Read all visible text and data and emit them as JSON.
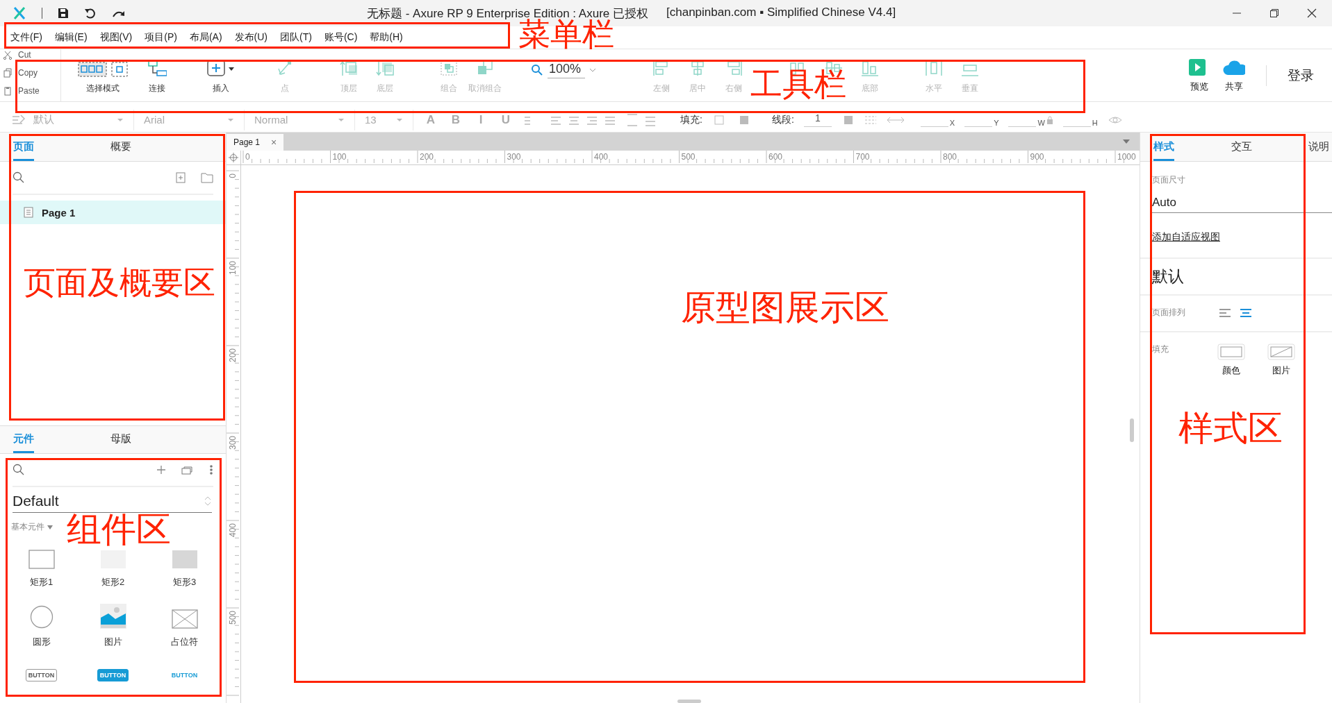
{
  "window": {
    "title": "无标题 - Axure RP 9 Enterprise Edition : Axure 已授权",
    "title_suffix": "[chanpinban.com ▪ Simplified Chinese V4.4]"
  },
  "menu": [
    "文件(F)",
    "编辑(E)",
    "视图(V)",
    "项目(P)",
    "布局(A)",
    "发布(U)",
    "团队(T)",
    "账号(C)",
    "帮助(H)"
  ],
  "clipboard": [
    "Cut",
    "Copy",
    "Paste"
  ],
  "toolbar": {
    "groups": [
      [
        {
          "label": "选择模式",
          "kind": "select",
          "disabled": false
        }
      ],
      [
        {
          "label": "连接",
          "kind": "connect",
          "disabled": false
        }
      ],
      [
        {
          "label": "插入",
          "kind": "insert",
          "disabled": false
        }
      ],
      [
        {
          "label": "点",
          "kind": "point",
          "disabled": true
        }
      ],
      [
        {
          "label": "顶层",
          "kind": "front",
          "disabled": true
        },
        {
          "label": "底层",
          "kind": "back",
          "disabled": true
        }
      ],
      [
        {
          "label": "组合",
          "kind": "group",
          "disabled": true
        },
        {
          "label": "取消组合",
          "kind": "ungroup",
          "disabled": true
        }
      ],
      [
        {
          "kind": "zoom",
          "value": "100%"
        }
      ],
      [
        {
          "label": "左侧",
          "kind": "align-left",
          "disabled": true
        },
        {
          "label": "居中",
          "kind": "align-center",
          "disabled": true
        },
        {
          "label": "右侧",
          "kind": "align-right",
          "disabled": true
        }
      ],
      [
        {
          "kind": "align-top",
          "disabled": true
        },
        {
          "kind": "align-middle",
          "disabled": true
        },
        {
          "label": "底部",
          "kind": "align-bottom",
          "disabled": true
        }
      ],
      [
        {
          "label": "水平",
          "kind": "dist-h",
          "disabled": true
        },
        {
          "label": "垂直",
          "kind": "dist-v",
          "disabled": true
        }
      ]
    ]
  },
  "toolbar_right": [
    {
      "label": "预览",
      "kind": "preview"
    },
    {
      "label": "共享",
      "kind": "share"
    }
  ],
  "login": "登录",
  "format_bar": [
    {
      "kind": "dropdown",
      "value": "默认"
    },
    {
      "kind": "dropdown",
      "value": "Arial"
    },
    {
      "kind": "dropdown",
      "value": "Normal"
    },
    {
      "kind": "dropdown",
      "value": "13"
    },
    {
      "kind": "glyph",
      "text": "A"
    },
    {
      "kind": "glyph",
      "text": "B"
    },
    {
      "kind": "glyph",
      "text": "I"
    },
    {
      "kind": "glyph",
      "text": "U"
    },
    {
      "kind": "text-align"
    },
    {
      "kind": "label",
      "text": "填充:"
    },
    {
      "kind": "fill"
    },
    {
      "kind": "label",
      "text": "线段:"
    },
    {
      "kind": "field",
      "value": "1"
    },
    {
      "kind": "stroke"
    },
    {
      "kind": "field",
      "label": "X"
    },
    {
      "kind": "field",
      "label": "Y"
    },
    {
      "kind": "field",
      "label": "W"
    },
    {
      "kind": "lock"
    },
    {
      "kind": "field",
      "label": "H"
    },
    {
      "kind": "eye"
    }
  ],
  "pages_panel": {
    "tabs": [
      {
        "label": "页面",
        "selected": true
      },
      {
        "label": "概要",
        "selected": false
      }
    ],
    "pages": [
      {
        "label": "Page 1",
        "selected": true
      }
    ]
  },
  "components_panel": {
    "tabs": [
      {
        "label": "元件",
        "selected": true
      },
      {
        "label": "母版",
        "selected": false
      }
    ],
    "library": "Default",
    "category": "基本元件",
    "widgets": [
      {
        "kind": "rect1",
        "label": "矩形1"
      },
      {
        "kind": "rect2",
        "label": "矩形2"
      },
      {
        "kind": "rect3",
        "label": "矩形3"
      },
      {
        "kind": "circle",
        "label": "圆形"
      },
      {
        "kind": "image",
        "label": "图片"
      },
      {
        "kind": "placeholder",
        "label": "占位符"
      },
      {
        "kind": "button",
        "label": "BUTTON"
      },
      {
        "kind": "primary",
        "label": "BUTTON"
      },
      {
        "kind": "link",
        "label": "BUTTON"
      }
    ]
  },
  "document_tabs": [
    {
      "label": "Page 1",
      "selected": true,
      "close": "×"
    }
  ],
  "ruler": {
    "horizontal": [
      "0",
      "100",
      "200",
      "300",
      "400",
      "500",
      "600",
      "700",
      "800",
      "900",
      "1000"
    ],
    "vertical": [
      "0",
      "100",
      "200",
      "300",
      "400",
      "500"
    ]
  },
  "style_panel": {
    "tabs": [
      {
        "label": "样式",
        "selected": true
      },
      {
        "label": "交互",
        "selected": false
      },
      {
        "label": "说明",
        "selected": false
      }
    ],
    "page_size_label": "页面尺寸",
    "page_size": "Auto",
    "adaptive_link": "添加自适应视图",
    "style_name": "默认",
    "align_label": "页面排列",
    "align_options": [
      {
        "kind": "left",
        "selected": false
      },
      {
        "kind": "center",
        "selected": true
      }
    ],
    "fill_label": "填充",
    "fill_options": [
      {
        "kind": "color",
        "label": "颜色"
      },
      {
        "kind": "image",
        "label": "图片"
      }
    ]
  },
  "annotations": [
    "菜单栏",
    "工具栏",
    "页面及概要区",
    "原型图展示区",
    "组件区",
    "样式区"
  ]
}
